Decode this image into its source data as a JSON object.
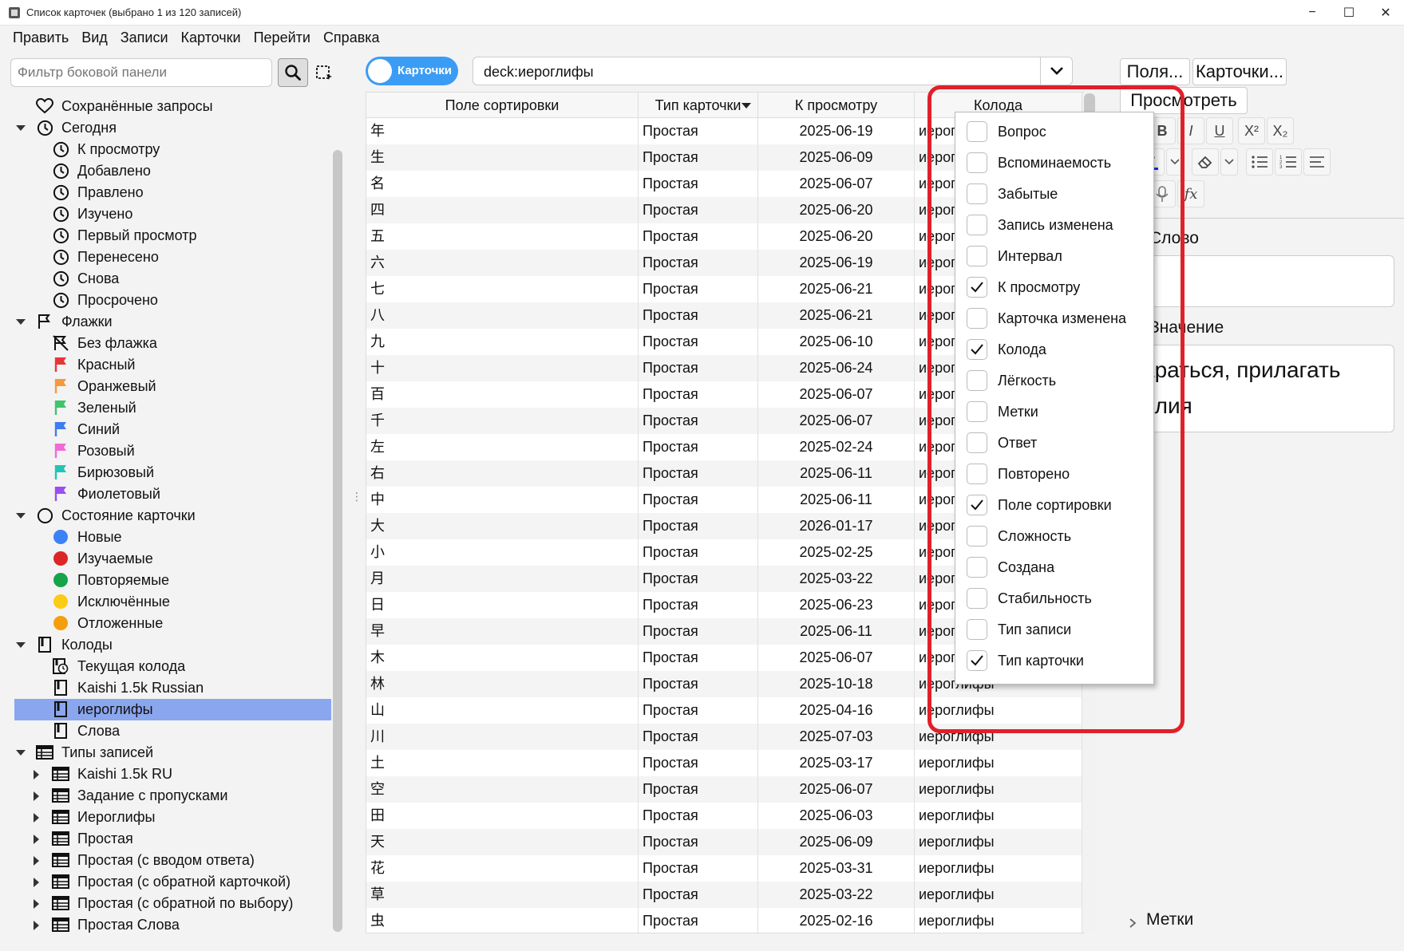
{
  "window": {
    "title": "Список карточек (выбрано 1 из 120 записей)",
    "minimize": "−",
    "maximize": "☐",
    "close": "✕"
  },
  "menu": [
    "Править",
    "Вид",
    "Записи",
    "Карточки",
    "Перейти",
    "Справка"
  ],
  "sidebar": {
    "search_placeholder": "Фильтр боковой панели",
    "tree": [
      {
        "label": "Сохранённые запросы",
        "level": 0,
        "icon": "heart-icon",
        "arrow": ""
      },
      {
        "label": "Сегодня",
        "level": 0,
        "icon": "clock-icon",
        "arrow": "down"
      },
      {
        "label": "К просмотру",
        "level": 1,
        "icon": "clock-icon",
        "arrow": ""
      },
      {
        "label": "Добавлено",
        "level": 1,
        "icon": "clock-icon",
        "arrow": ""
      },
      {
        "label": "Правлено",
        "level": 1,
        "icon": "clock-icon",
        "arrow": ""
      },
      {
        "label": "Изучено",
        "level": 1,
        "icon": "clock-icon",
        "arrow": ""
      },
      {
        "label": "Первый просмотр",
        "level": 1,
        "icon": "clock-icon",
        "arrow": ""
      },
      {
        "label": "Перенесено",
        "level": 1,
        "icon": "clock-icon",
        "arrow": ""
      },
      {
        "label": "Снова",
        "level": 1,
        "icon": "clock-icon",
        "arrow": ""
      },
      {
        "label": "Просрочено",
        "level": 1,
        "icon": "clock-icon",
        "arrow": ""
      },
      {
        "label": "Флажки",
        "level": 0,
        "icon": "flag-outline-icon",
        "arrow": "down"
      },
      {
        "label": "Без флажка",
        "level": 1,
        "icon": "flag-off-icon",
        "arrow": ""
      },
      {
        "label": "Красный",
        "level": 1,
        "icon": "flag-icon",
        "color": "#e8353a",
        "arrow": ""
      },
      {
        "label": "Оранжевый",
        "level": 1,
        "icon": "flag-icon",
        "color": "#f59a3c",
        "arrow": ""
      },
      {
        "label": "Зеленый",
        "level": 1,
        "icon": "flag-icon",
        "color": "#3fc46a",
        "arrow": ""
      },
      {
        "label": "Синий",
        "level": 1,
        "icon": "flag-icon",
        "color": "#3f7cf0",
        "arrow": ""
      },
      {
        "label": "Розовый",
        "level": 1,
        "icon": "flag-icon",
        "color": "#f06bd6",
        "arrow": ""
      },
      {
        "label": "Бирюзовый",
        "level": 1,
        "icon": "flag-icon",
        "color": "#23c4b6",
        "arrow": ""
      },
      {
        "label": "Фиолетовый",
        "level": 1,
        "icon": "flag-icon",
        "color": "#9b4ff0",
        "arrow": ""
      },
      {
        "label": "Состояние карточки",
        "level": 0,
        "icon": "circle-outline-icon",
        "arrow": "down"
      },
      {
        "label": "Новые",
        "level": 1,
        "icon": "dot-icon",
        "color": "#3b82f6",
        "arrow": ""
      },
      {
        "label": "Изучаемые",
        "level": 1,
        "icon": "dot-icon",
        "color": "#dc2626",
        "arrow": ""
      },
      {
        "label": "Повторяемые",
        "level": 1,
        "icon": "dot-icon",
        "color": "#16a34a",
        "arrow": ""
      },
      {
        "label": "Исключённые",
        "level": 1,
        "icon": "dot-icon",
        "color": "#facc15",
        "arrow": ""
      },
      {
        "label": "Отложенные",
        "level": 1,
        "icon": "dot-icon",
        "color": "#f59e0b",
        "arrow": ""
      },
      {
        "label": "Колоды",
        "level": 0,
        "icon": "deck-icon",
        "arrow": "down"
      },
      {
        "label": "Текущая колода",
        "level": 1,
        "icon": "deck-clock-icon",
        "arrow": ""
      },
      {
        "label": "Kaishi 1.5k Russian",
        "level": 1,
        "icon": "deck-icon",
        "arrow": ""
      },
      {
        "label": "иероглифы",
        "level": 1,
        "icon": "deck-icon",
        "arrow": "",
        "selected": true
      },
      {
        "label": "Слова",
        "level": 1,
        "icon": "deck-icon",
        "arrow": ""
      },
      {
        "label": "Типы записей",
        "level": 0,
        "icon": "table-icon",
        "arrow": "down"
      },
      {
        "label": "Kaishi 1.5k RU",
        "level": 1,
        "icon": "table-icon",
        "arrow": "right"
      },
      {
        "label": "Задание с пропусками",
        "level": 1,
        "icon": "table-icon",
        "arrow": "right"
      },
      {
        "label": "Иероглифы",
        "level": 1,
        "icon": "table-icon",
        "arrow": "right"
      },
      {
        "label": "Простая",
        "level": 1,
        "icon": "table-icon",
        "arrow": "right"
      },
      {
        "label": "Простая (с вводом ответа)",
        "level": 1,
        "icon": "table-icon",
        "arrow": "right"
      },
      {
        "label": "Простая (с обратной карточкой)",
        "level": 1,
        "icon": "table-icon",
        "arrow": "right"
      },
      {
        "label": "Простая (с обратной по выбору)",
        "level": 1,
        "icon": "table-icon",
        "arrow": "right"
      },
      {
        "label": "Простая Слова",
        "level": 1,
        "icon": "table-icon",
        "arrow": "right"
      }
    ]
  },
  "toolbar": {
    "toggle_label": "Карточки",
    "search_value": "deck:иероглифы"
  },
  "table": {
    "columns": [
      "Поле сортировки",
      "Тип карточки",
      "К просмотру",
      "Колода"
    ],
    "rows": [
      [
        "年",
        "Простая",
        "2025-06-19",
        "иероглифы"
      ],
      [
        "生",
        "Простая",
        "2025-06-09",
        "иероглифы"
      ],
      [
        "名",
        "Простая",
        "2025-06-07",
        "иероглифы"
      ],
      [
        "四",
        "Простая",
        "2025-06-20",
        "иероглифы"
      ],
      [
        "五",
        "Простая",
        "2025-06-20",
        "иероглифы"
      ],
      [
        "六",
        "Простая",
        "2025-06-19",
        "иероглифы"
      ],
      [
        "七",
        "Простая",
        "2025-06-21",
        "иероглифы"
      ],
      [
        "八",
        "Простая",
        "2025-06-21",
        "иероглифы"
      ],
      [
        "九",
        "Простая",
        "2025-06-10",
        "иероглифы"
      ],
      [
        "十",
        "Простая",
        "2025-06-24",
        "иероглифы"
      ],
      [
        "百",
        "Простая",
        "2025-06-07",
        "иероглифы"
      ],
      [
        "千",
        "Простая",
        "2025-06-07",
        "иероглифы"
      ],
      [
        "左",
        "Простая",
        "2025-02-24",
        "иероглифы"
      ],
      [
        "右",
        "Простая",
        "2025-06-11",
        "иероглифы"
      ],
      [
        "中",
        "Простая",
        "2025-06-11",
        "иероглифы"
      ],
      [
        "大",
        "Простая",
        "2026-01-17",
        "иероглифы"
      ],
      [
        "小",
        "Простая",
        "2025-02-25",
        "иероглифы"
      ],
      [
        "月",
        "Простая",
        "2025-03-22",
        "иероглифы"
      ],
      [
        "日",
        "Простая",
        "2025-06-23",
        "иероглифы"
      ],
      [
        "早",
        "Простая",
        "2025-06-11",
        "иероглифы"
      ],
      [
        "木",
        "Простая",
        "2025-06-07",
        "иероглифы"
      ],
      [
        "林",
        "Простая",
        "2025-10-18",
        "иероглифы"
      ],
      [
        "山",
        "Простая",
        "2025-04-16",
        "иероглифы"
      ],
      [
        "川",
        "Простая",
        "2025-07-03",
        "иероглифы"
      ],
      [
        "土",
        "Простая",
        "2025-03-17",
        "иероглифы"
      ],
      [
        "空",
        "Простая",
        "2025-06-07",
        "иероглифы"
      ],
      [
        "田",
        "Простая",
        "2025-06-03",
        "иероглифы"
      ],
      [
        "天",
        "Простая",
        "2025-06-09",
        "иероглифы"
      ],
      [
        "花",
        "Простая",
        "2025-03-31",
        "иероглифы"
      ],
      [
        "草",
        "Простая",
        "2025-03-22",
        "иероглифы"
      ],
      [
        "虫",
        "Простая",
        "2025-02-16",
        "иероглифы"
      ]
    ]
  },
  "editor": {
    "fields_button": "Поля...",
    "cards_button": "Карточки...",
    "preview_button": "Просмотреть",
    "field1_label": "Слово",
    "field2_label": "Значение",
    "field2_value_line1": "араться, прилагать",
    "field2_value_line2": "илия",
    "tags_label": "Метки",
    "format": {
      "bold": "B",
      "italic": "I",
      "underline": "U",
      "superscript": "X²",
      "subscript": "X₂",
      "function": "fx"
    }
  },
  "column_menu": [
    {
      "label": "Вопрос",
      "checked": false
    },
    {
      "label": "Вспоминаемость",
      "checked": false
    },
    {
      "label": "Забытые",
      "checked": false
    },
    {
      "label": "Запись изменена",
      "checked": false
    },
    {
      "label": "Интервал",
      "checked": false
    },
    {
      "label": "К просмотру",
      "checked": true
    },
    {
      "label": "Карточка изменена",
      "checked": false
    },
    {
      "label": "Колода",
      "checked": true
    },
    {
      "label": "Лёгкость",
      "checked": false
    },
    {
      "label": "Метки",
      "checked": false
    },
    {
      "label": "Ответ",
      "checked": false
    },
    {
      "label": "Повторено",
      "checked": false
    },
    {
      "label": "Поле сортировки",
      "checked": true
    },
    {
      "label": "Сложность",
      "checked": false
    },
    {
      "label": "Создана",
      "checked": false
    },
    {
      "label": "Стабильность",
      "checked": false
    },
    {
      "label": "Тип записи",
      "checked": false
    },
    {
      "label": "Тип карточки",
      "checked": true
    }
  ],
  "colors": {
    "accent": "#3b9cf5",
    "selection": "#8aa6ee",
    "highlight": "#e0202a"
  }
}
